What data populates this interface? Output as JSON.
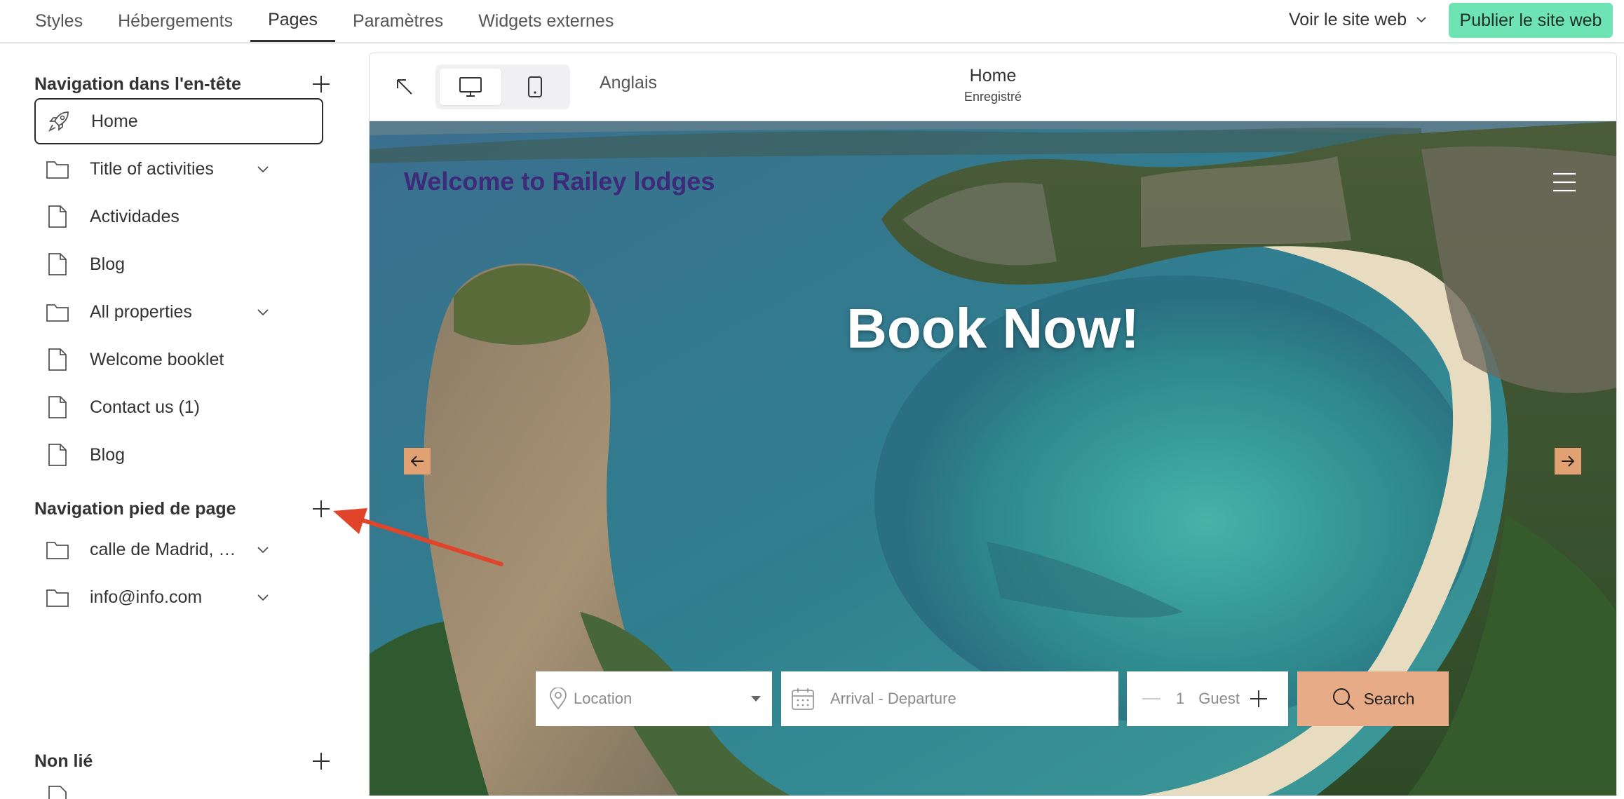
{
  "topbar": {
    "tabs": [
      {
        "label": "Styles"
      },
      {
        "label": "Hébergements"
      },
      {
        "label": "Pages"
      },
      {
        "label": "Paramètres"
      },
      {
        "label": "Widgets externes"
      }
    ],
    "active_tab": "Pages",
    "view_site_label": "Voir le site web",
    "publish_label": "Publier le site web",
    "publish_color": "#6ee3b4"
  },
  "sidebar": {
    "header_nav": {
      "title": "Navigation dans l'en-tête",
      "items": [
        {
          "label": "Home",
          "icon": "rocket-icon",
          "selected": true
        },
        {
          "label": "Title of activities",
          "icon": "folder-icon",
          "expandable": true
        },
        {
          "label": "Actividades",
          "icon": "page-icon"
        },
        {
          "label": "Blog",
          "icon": "page-icon"
        },
        {
          "label": "All properties",
          "icon": "folder-icon",
          "expandable": true
        },
        {
          "label": "Welcome booklet",
          "icon": "page-icon"
        },
        {
          "label": "Contact us (1)",
          "icon": "page-icon"
        },
        {
          "label": "Blog",
          "icon": "page-icon"
        }
      ]
    },
    "footer_nav": {
      "title": "Navigation pied de page",
      "items": [
        {
          "label": "calle de Madrid, …",
          "icon": "folder-icon",
          "expandable": true
        },
        {
          "label": "info@info.com",
          "icon": "folder-icon",
          "expandable": true
        }
      ]
    },
    "unlinked": {
      "title": "Non lié"
    }
  },
  "preview": {
    "language": "Anglais",
    "page_title": "Home",
    "page_status": "Enregistré",
    "site_title": "Welcome to Railey lodges",
    "site_title_color": "#3d2a7a",
    "hero_heading": "Book Now!",
    "search": {
      "location_placeholder": "Location",
      "dates_placeholder": "Arrival - Departure",
      "guest_count": "1",
      "guest_label": "Guest",
      "button_label": "Search",
      "button_color": "#e7ac87"
    },
    "slider_arrow_color": "#e2a173"
  },
  "annotation": {
    "arrow_color": "#e0452b"
  }
}
